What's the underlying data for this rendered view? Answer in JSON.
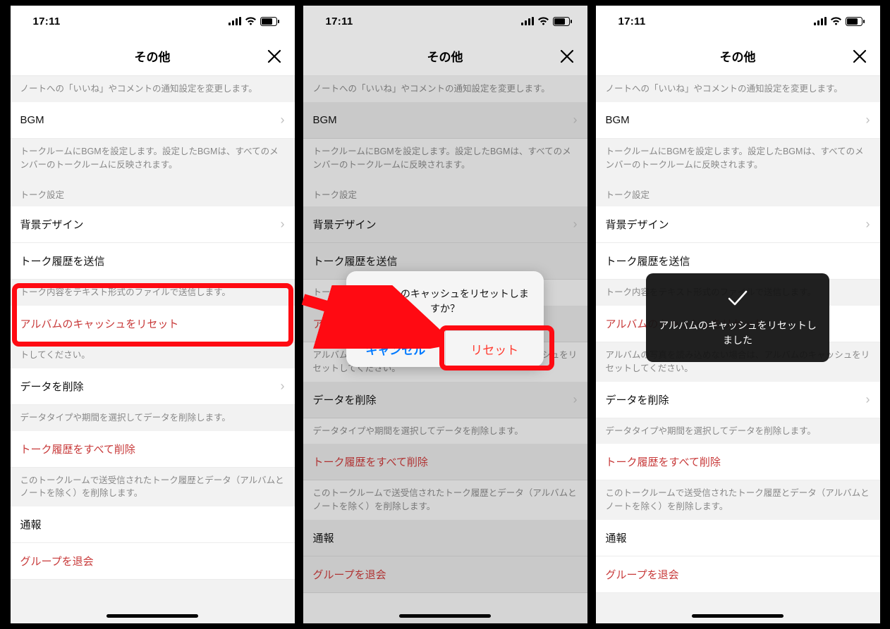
{
  "status": {
    "time": "17:11"
  },
  "nav": {
    "title": "その他"
  },
  "sections": {
    "desc_note": "ノートへの「いいね」やコメントの通知設定を変更します。",
    "bgm": "BGM",
    "desc_bgm": "トークルームにBGMを設定します。設定したBGMは、すべてのメンバーのトークルームに反映されます。",
    "label_talk": "トーク設定",
    "bg_design": "背景デザイン",
    "send_history": "トーク履歴を送信",
    "desc_send": "トーク内容をテキスト形式のファイルで送信します。",
    "reset_cache": "アルバムのキャッシュをリセット",
    "desc_reset_partial": "トしてください。",
    "desc_reset_full": "アルバムの写真を読み込めない場合は、アルバムのキャッシュをリセットしてください。",
    "delete_data": "データを削除",
    "desc_delete": "データタイプや期間を選択してデータを削除します。",
    "delete_all_history": "トーク履歴をすべて削除",
    "desc_delete_all": "このトークルームで送受信されたトーク履歴とデータ（アルバムとノートを除く）を削除します。",
    "report": "通報",
    "leave_group": "グループを退会"
  },
  "dialog": {
    "message": "アルバムのキャッシュをリセットしますか？",
    "cancel": "キャンセル",
    "confirm": "リセット"
  },
  "toast": {
    "text": "アルバムのキャッシュをリセットしました"
  }
}
